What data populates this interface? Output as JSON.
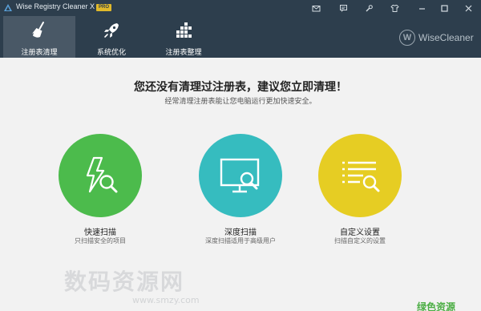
{
  "window": {
    "title": "Wise Registry Cleaner X",
    "badge": "PRO",
    "buttons": [
      "mail-icon",
      "feedback-icon",
      "settings-icon",
      "skin-icon",
      "minimize-icon",
      "maximize-icon",
      "close-icon"
    ]
  },
  "nav": {
    "tabs": [
      {
        "label": "注册表清理",
        "icon": "broom-icon",
        "active": true
      },
      {
        "label": "系统优化",
        "icon": "rocket-icon",
        "active": false
      },
      {
        "label": "注册表整理",
        "icon": "defrag-blocks-icon",
        "active": false
      }
    ],
    "brand": {
      "letter": "W",
      "text": "WiseCleaner"
    }
  },
  "main": {
    "headline": "您还没有清理过注册表，建议您立即清理！",
    "subline": "经常清理注册表能让您电脑运行更加快速安全。"
  },
  "scans": [
    {
      "title": "快速扫描",
      "desc": "只扫描安全的项目",
      "color": "#4cbb4c",
      "icon": "quick-scan-icon"
    },
    {
      "title": "深度扫描",
      "desc": "深度扫描适用于高级用户",
      "color": "#36bcbf",
      "icon": "deep-scan-icon"
    },
    {
      "title": "自定义设置",
      "desc": "扫描自定义的设置",
      "color": "#e6cd23",
      "icon": "custom-scan-icon"
    }
  ],
  "watermark": {
    "text": "数码资源网",
    "url": "www.smzy.com",
    "corner": "绿色资源"
  },
  "colors": {
    "topbar": "#2d3e4d",
    "active_tab": "#495866",
    "background": "#f2f2f2"
  }
}
